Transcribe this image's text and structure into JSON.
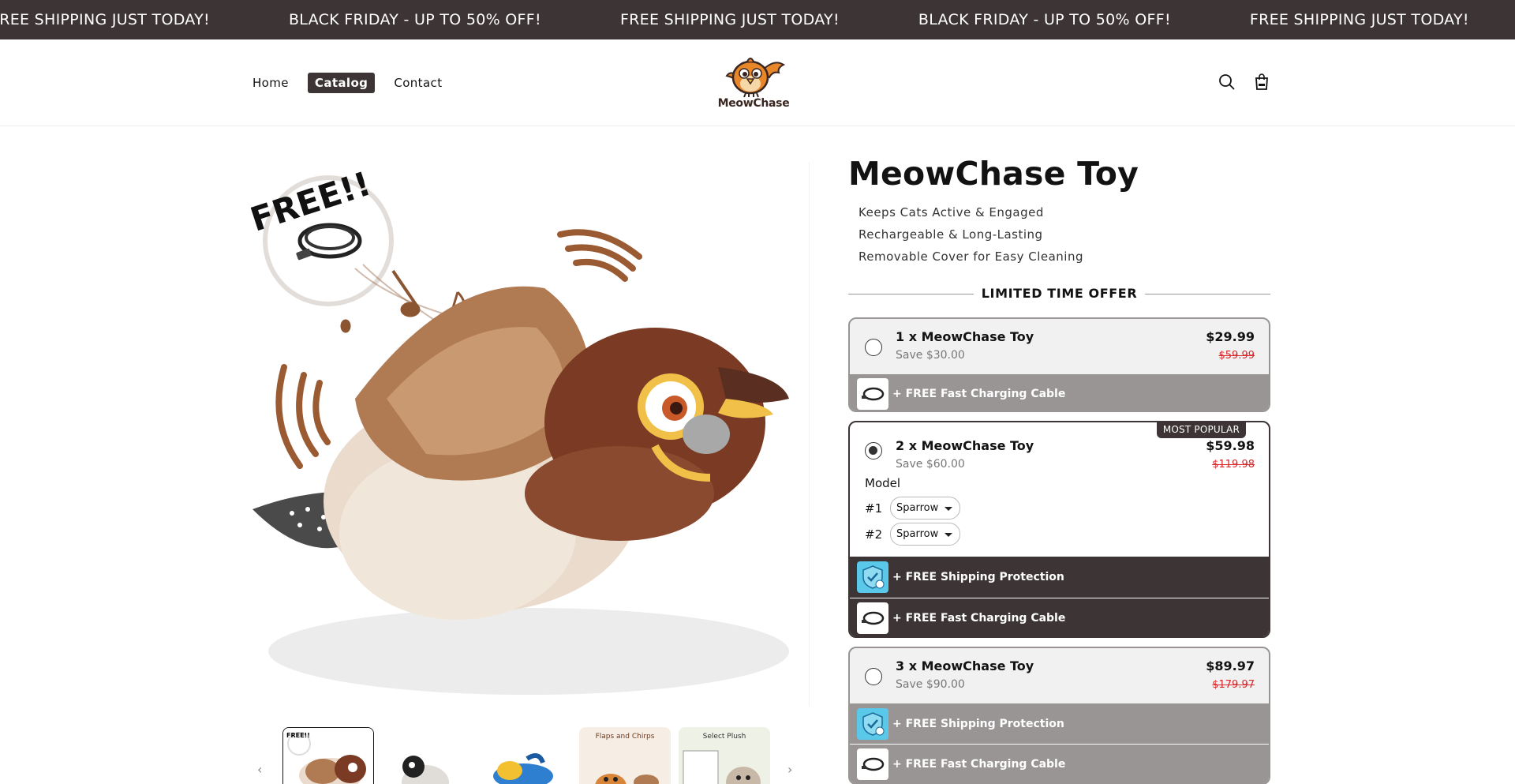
{
  "announcement": {
    "items": [
      "FREE SHIPPING JUST TODAY!",
      "BLACK FRIDAY - UP TO 50% OFF!",
      "FREE SHIPPING JUST TODAY!",
      "BLACK FRIDAY - UP TO 50% OFF!",
      "FREE SHIPPING JUST TODAY!"
    ]
  },
  "nav": {
    "items": [
      {
        "label": "Home",
        "active": false
      },
      {
        "label": "Catalog",
        "active": true
      },
      {
        "label": "Contact",
        "active": false
      }
    ]
  },
  "brand": {
    "logo_text": "MeowChase",
    "color_dark": "#3d3535",
    "color_orange": "#e8862a"
  },
  "header_icons": [
    "search-icon",
    "cart-icon"
  ],
  "media": {
    "main_badge": "FREE!!",
    "thumbnails": [
      {
        "name": "thumb-1",
        "caption": "FREE!!"
      },
      {
        "name": "thumb-2",
        "caption": ""
      },
      {
        "name": "thumb-3",
        "caption": ""
      },
      {
        "name": "thumb-4",
        "caption": "Flaps and Chirps"
      },
      {
        "name": "thumb-5",
        "caption": "Select Plush"
      }
    ],
    "prev_arrow": "‹",
    "next_arrow": "›"
  },
  "product": {
    "title": "MeowChase Toy",
    "bullets": [
      "Keeps Cats Active & Engaged",
      "Rechargeable & Long-Lasting",
      "Removable Cover for Easy Cleaning"
    ],
    "offer_heading": "LIMITED TIME OFFER"
  },
  "bundles": [
    {
      "title": "1 x MeowChase Toy",
      "save": "Save $30.00",
      "price": "$29.99",
      "old_price": "$59.99",
      "selected": false,
      "gifts": [
        "+ FREE Fast Charging Cable"
      ]
    },
    {
      "title": "2 x MeowChase Toy",
      "save": "Save $60.00",
      "price": "$59.98",
      "old_price": "$119.98",
      "selected": true,
      "badge": "MOST POPULAR",
      "model_label": "Model",
      "models": [
        {
          "num": "#1",
          "value": "Sparrow"
        },
        {
          "num": "#2",
          "value": "Sparrow"
        }
      ],
      "gifts": [
        "+ FREE Shipping Protection",
        "+ FREE Fast Charging Cable"
      ]
    },
    {
      "title": "3 x MeowChase Toy",
      "save": "Save $90.00",
      "price": "$89.97",
      "old_price": "$179.97",
      "selected": false,
      "gifts": [
        "+ FREE Shipping Protection",
        "+ FREE Fast Charging Cable"
      ]
    }
  ]
}
